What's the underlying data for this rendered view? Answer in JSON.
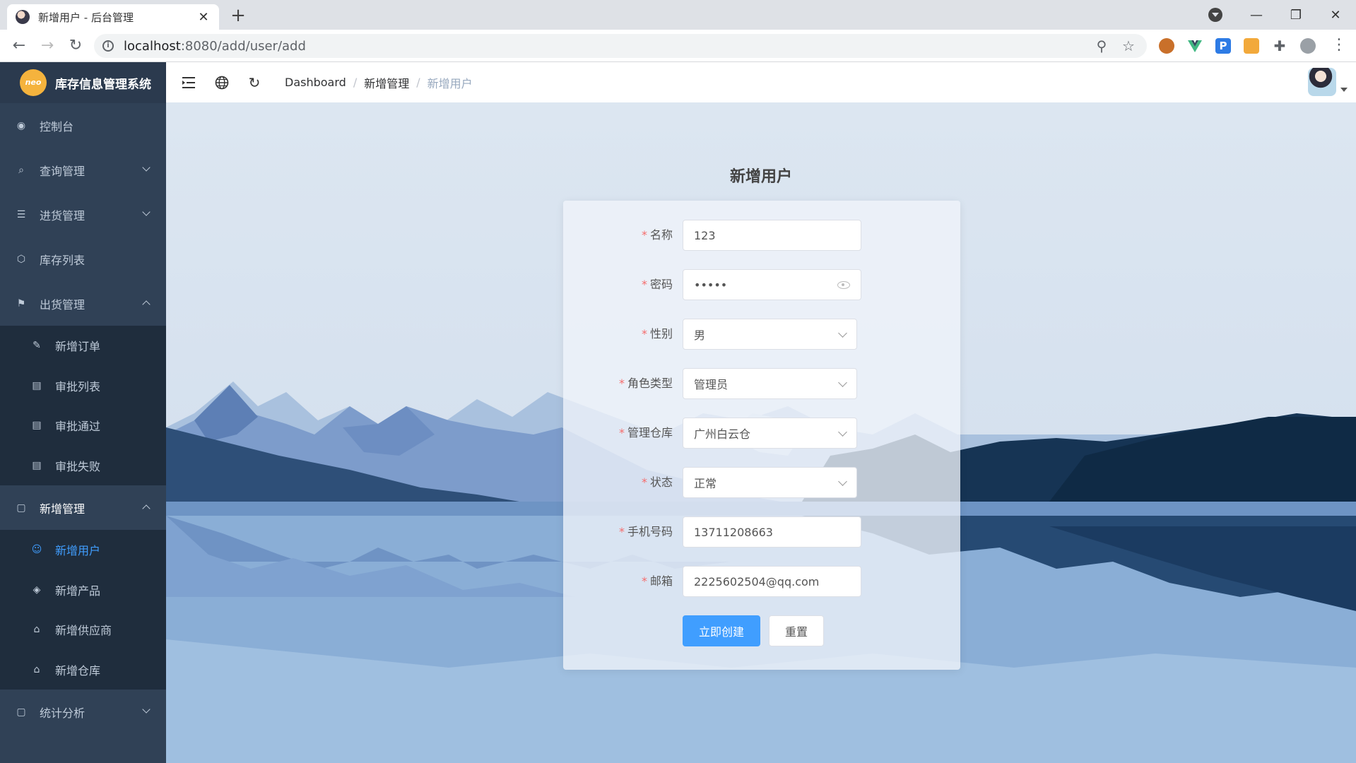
{
  "browser": {
    "tab_title": "新增用户 - 后台管理",
    "tab_close": "✕",
    "new_tab": "+",
    "url_host": "localhost",
    "url_rest": ":8080/add/user/add"
  },
  "app": {
    "logo_mark": "neo",
    "title": "库存信息管理系统"
  },
  "sidebar": {
    "items": [
      {
        "label": "控制台",
        "icon": "dashboard-icon"
      },
      {
        "label": "查询管理",
        "icon": "search-doc-icon"
      },
      {
        "label": "进货管理",
        "icon": "list-icon"
      },
      {
        "label": "库存列表",
        "icon": "cube-icon"
      },
      {
        "label": "出货管理",
        "icon": "shipping-icon"
      }
    ],
    "shipping_sub": [
      {
        "label": "新增订单",
        "icon": "edit-doc-icon"
      },
      {
        "label": "审批列表",
        "icon": "doc-list-icon"
      },
      {
        "label": "审批通过",
        "icon": "doc-check-icon"
      },
      {
        "label": "审批失败",
        "icon": "doc-fail-icon"
      }
    ],
    "add_mgmt": {
      "label": "新增管理",
      "icon": "new-doc-icon"
    },
    "add_sub": [
      {
        "label": "新增用户",
        "icon": "user-icon"
      },
      {
        "label": "新增产品",
        "icon": "box-icon"
      },
      {
        "label": "新增供应商",
        "icon": "store-icon"
      },
      {
        "label": "新增仓库",
        "icon": "warehouse-icon"
      }
    ],
    "stats": {
      "label": "统计分析",
      "icon": "stats-doc-icon"
    }
  },
  "navbar": {
    "breadcrumb": [
      "Dashboard",
      "新增管理",
      "新增用户"
    ],
    "separator": "/"
  },
  "page": {
    "title": "新增用户"
  },
  "form": {
    "required_mark": "*",
    "fields": {
      "name": {
        "label": "名称",
        "value": "123"
      },
      "password": {
        "label": "密码",
        "value": "•••••"
      },
      "gender": {
        "label": "性别",
        "value": "男"
      },
      "role": {
        "label": "角色类型",
        "value": "管理员"
      },
      "warehouse": {
        "label": "管理仓库",
        "value": "广州白云仓"
      },
      "status": {
        "label": "状态",
        "value": "正常"
      },
      "phone": {
        "label": "手机号码",
        "value": "13711208663"
      },
      "email": {
        "label": "邮箱",
        "value": "2225602504@qq.com"
      }
    },
    "submit_label": "立即创建",
    "reset_label": "重置"
  },
  "colors": {
    "sidebar_bg": "#304156",
    "submenu_bg": "#1f2d3d",
    "active": "#409eff",
    "required": "#f56c6c"
  }
}
